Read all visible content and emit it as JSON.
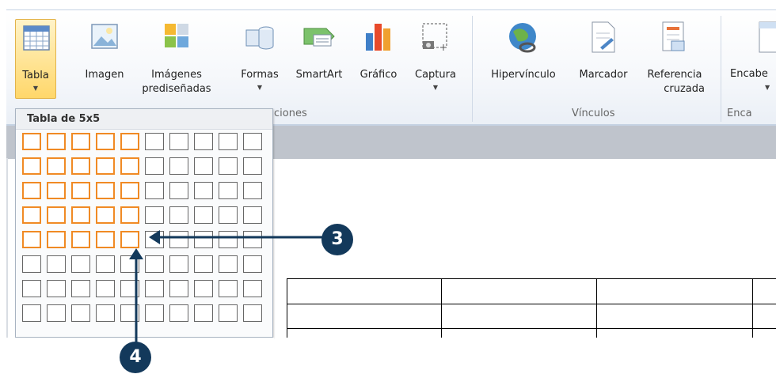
{
  "ribbon": {
    "buttons": [
      {
        "id": "tabla",
        "label": "Tabla",
        "has_caret": true
      },
      {
        "id": "imagen",
        "label": "Imagen"
      },
      {
        "id": "imagenes",
        "label_line1": "Imágenes",
        "label_line2": "prediseñadas"
      },
      {
        "id": "formas",
        "label": "Formas",
        "has_caret": true
      },
      {
        "id": "smartart",
        "label": "SmartArt"
      },
      {
        "id": "grafico",
        "label": "Gráfico"
      },
      {
        "id": "captura",
        "label": "Captura",
        "has_caret": true
      },
      {
        "id": "hipervinculo",
        "label": "Hipervínculo"
      },
      {
        "id": "marcador",
        "label": "Marcador"
      },
      {
        "id": "referencia",
        "label_line1": "Referencia",
        "label_line2": "cruzada"
      },
      {
        "id": "encabezado",
        "label": "Encabe",
        "has_caret": true
      }
    ],
    "groups": {
      "ilustraciones_partial": "ciones",
      "vinculos": "Vínculos",
      "encabezado_partial": "Enca"
    }
  },
  "dropdown": {
    "title": "Tabla de 5x5",
    "grid_cols": 10,
    "grid_rows": 8,
    "selected_cols": 5,
    "selected_rows": 5
  },
  "annotations": [
    {
      "number": "3"
    },
    {
      "number": "4"
    }
  ],
  "colors": {
    "accent_orange": "#f08a24",
    "badge_navy": "#13395b",
    "ribbon_highlight": "#ffd76a"
  }
}
